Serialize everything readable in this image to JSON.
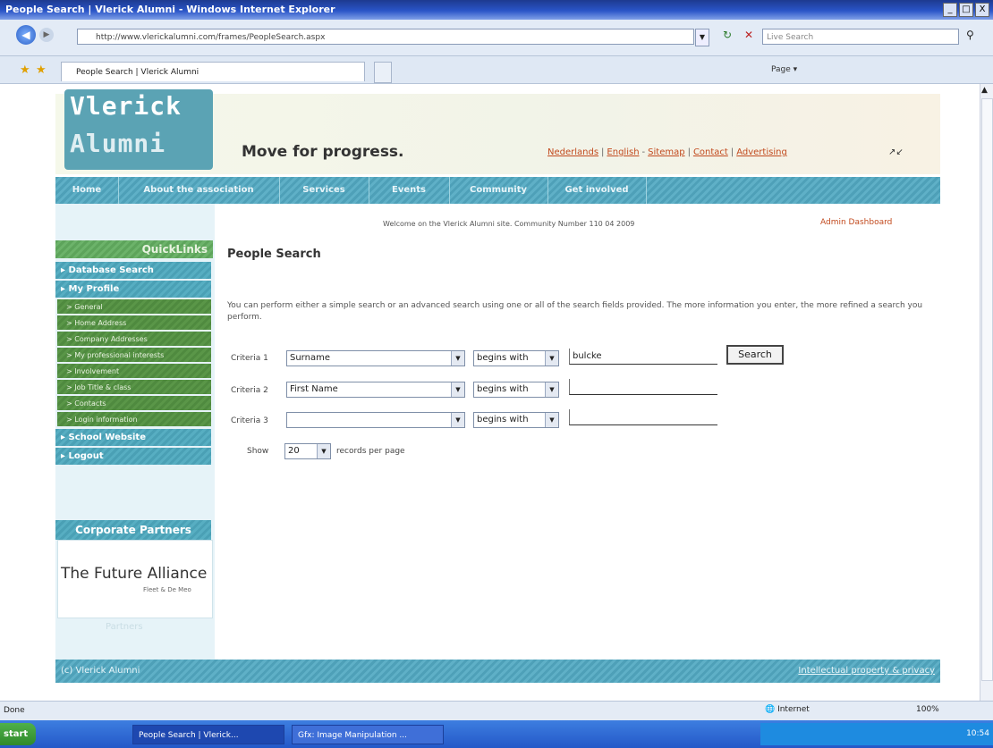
{
  "window": {
    "title": "People Search | Vlerick Alumni - Windows Internet Explorer",
    "buttons": [
      "_",
      "□",
      "X"
    ]
  },
  "browser": {
    "address": "http://www.vlerickalumni.com/frames/PeopleSearch.aspx",
    "search_placeholder": "Live Search",
    "tab_label": "People Search | Vlerick Alumni",
    "toolbar": "Page ▾"
  },
  "site": {
    "logo_line1": "Vlerick",
    "logo_line2": "Alumni",
    "tagline": "Move for progress.",
    "top_links": [
      "Nederlands",
      "English",
      "Sitemap",
      "Contact",
      "Advertising"
    ],
    "nav": [
      "Home",
      "About the association",
      "Services",
      "Events",
      "Community",
      "Get involved"
    ],
    "welcome": "Welcome on the Vlerick Alumni site. Community Number 110 04 2009",
    "admin": "Admin Dashboard"
  },
  "sidebar": {
    "quicklinks": "QuickLinks",
    "top_items": [
      "Database Search",
      "My Profile"
    ],
    "sub_items": [
      "General",
      "Home Address",
      "Company Addresses",
      "My professional interests",
      "Involvement",
      "Job Title & class",
      "Contacts",
      "Login information"
    ],
    "bottom_items": [
      "School Website",
      "Logout"
    ],
    "corporate_header": "Corporate Partners",
    "partner_name": "The Future Alliance",
    "partner_sub": "Fleet & De Meo",
    "partner_faint": "Partners"
  },
  "main": {
    "title": "People Search",
    "intro": "You can perform either a simple search or an advanced search using one or all of the search fields provided. The more information you enter, the more refined a search you perform.",
    "criteria": [
      {
        "label": "Criteria 1",
        "field": "Surname",
        "op": "begins with",
        "value": "bulcke"
      },
      {
        "label": "Criteria 2",
        "field": "First Name",
        "op": "begins with",
        "value": ""
      },
      {
        "label": "Criteria 3",
        "field": "",
        "op": "begins with",
        "value": ""
      }
    ],
    "search_button": "Search",
    "show_label": "Show",
    "per_page_value": "20",
    "per_page_suffix": "records per page"
  },
  "footer": {
    "left": "(c) Vlerick Alumni",
    "right": "Intellectual property & privacy"
  },
  "statusbar": {
    "left": "Done",
    "zone": "Internet",
    "zoom": "100%"
  },
  "taskbar": {
    "start": "start",
    "task1": "People Search | Vlerick...",
    "task2": "Gfx: Image Manipulation ...",
    "clock": "10:54"
  }
}
